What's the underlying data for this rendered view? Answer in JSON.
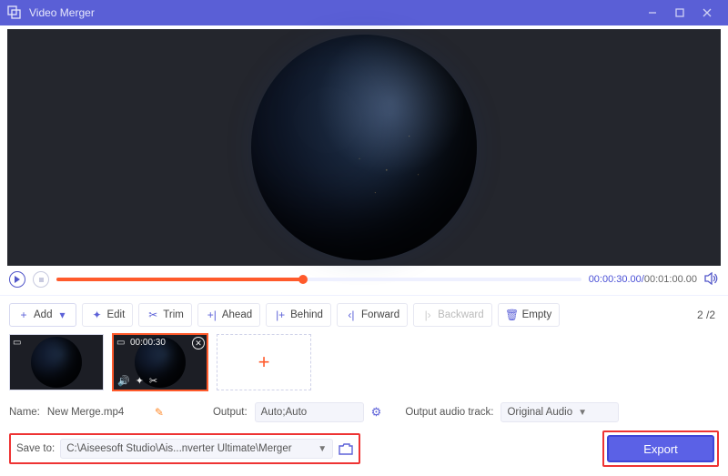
{
  "titlebar": {
    "title": "Video Merger"
  },
  "controls": {
    "time_current": "00:00:30.00",
    "time_total": "00:01:00.00"
  },
  "toolbar": {
    "add": "Add",
    "edit": "Edit",
    "trim": "Trim",
    "ahead": "Ahead",
    "behind": "Behind",
    "forward": "Forward",
    "backward": "Backward",
    "empty": "Empty",
    "counter": "2 /2"
  },
  "clips": {
    "sel_duration": "00:00:30"
  },
  "form": {
    "name_label": "Name:",
    "name_value": "New Merge.mp4",
    "output_label": "Output:",
    "output_value": "Auto;Auto",
    "audio_label": "Output audio track:",
    "audio_value": "Original Audio",
    "saveto_label": "Save to:",
    "saveto_value": "C:\\Aiseesoft Studio\\Ais...nverter Ultimate\\Merger"
  },
  "export": {
    "label": "Export"
  }
}
